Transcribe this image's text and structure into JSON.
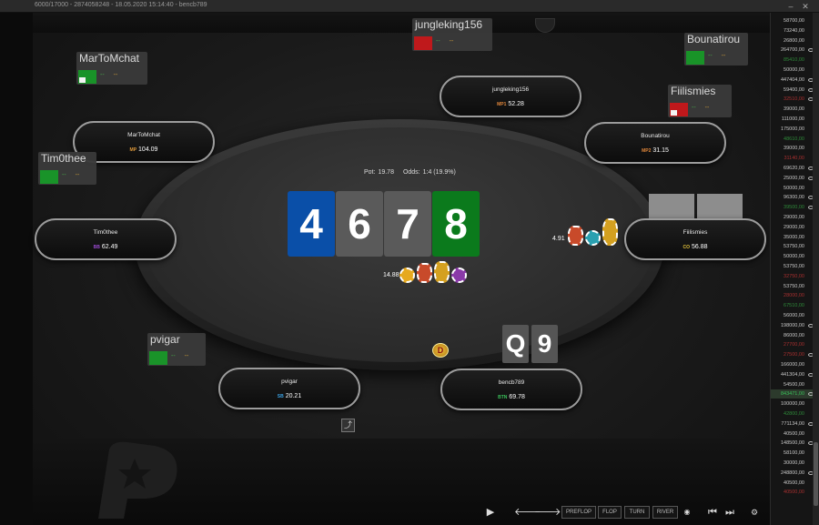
{
  "window": {
    "title": "6000/17000 - 2874058248 - 18.05.2020 15:14:40 - bencb789",
    "minimize_glyph": "–",
    "close_glyph": "✕"
  },
  "pot": {
    "pot_label": "Pot:",
    "pot_value": "19.78",
    "odds_label": "Odds:",
    "odds_value": "1:4 (19.9%)"
  },
  "board": [
    {
      "rank": "4",
      "color": "#0a4fa8"
    },
    {
      "rank": "6",
      "color": "#5a5a5a"
    },
    {
      "rank": "7",
      "color": "#5a5a5a"
    },
    {
      "rank": "8",
      "color": "#0b7a1c"
    }
  ],
  "hero_cards": [
    "Q",
    "9"
  ],
  "seats": [
    {
      "name": "jungleking156",
      "position": "MP1",
      "stack": "52.28",
      "pos_color": "#e0863a"
    },
    {
      "name": "MarToMchat",
      "position": "MP",
      "stack": "104.09",
      "pos_color": "#e09a3a"
    },
    {
      "name": "Bounatirou",
      "position": "MP2",
      "stack": "31.15",
      "pos_color": "#e0863a"
    },
    {
      "name": "Tim0thee",
      "position": "BB",
      "stack": "62.49",
      "pos_color": "#9a4ad0"
    },
    {
      "name": "Fiilismies",
      "position": "CO",
      "stack": "56.88",
      "pos_color": "#e0c03a"
    },
    {
      "name": "pvigar",
      "position": "SB",
      "stack": "20.21",
      "pos_color": "#3aa0e0"
    },
    {
      "name": "bencb789",
      "position": "BTN",
      "stack": "69.78",
      "pos_color": "#3ac05a"
    }
  ],
  "huds": [
    {
      "name": "jungleking156",
      "sq": "#c8191c",
      "stat_a": "--",
      "stat_b": "--"
    },
    {
      "name": "MarToMchat",
      "sq": "#1a9a2a",
      "stat_a": "--",
      "stat_b": "--"
    },
    {
      "name": "Bounatirou",
      "sq": "#1a9a2a",
      "stat_a": "--",
      "stat_b": "--"
    },
    {
      "name": "Fiilismies",
      "sq": "#c8191c",
      "stat_a": "--",
      "stat_b": "--"
    },
    {
      "name": "Tim0thee",
      "sq": "#1a9a2a",
      "stat_a": "--",
      "stat_b": "--"
    },
    {
      "name": "pvigar",
      "sq": "#1a9a2a",
      "stat_a": "--",
      "stat_b": "--"
    }
  ],
  "bets": {
    "pot_chips": "14.88",
    "fiilismies_bet": "4.91"
  },
  "dealer_label": "D",
  "controls": {
    "play": "▶",
    "prev": "🡐",
    "next": "🡒",
    "preflop": "PREFLOP",
    "flop": "FLOP",
    "turn": "TURN",
    "river": "RIVER",
    "eye": "◉",
    "first": "⏮",
    "last": "⏭",
    "settings": "⚙"
  },
  "side_list": [
    {
      "value": "58700,00",
      "color": "#c8c8c8",
      "eye": false
    },
    {
      "value": "73240,00",
      "color": "#c8c8c8",
      "eye": false
    },
    {
      "value": "26800,00",
      "color": "#c8c8c8",
      "eye": false
    },
    {
      "value": "264700,00",
      "color": "#c8c8c8",
      "eye": true
    },
    {
      "value": "85410,00",
      "color": "#2f8a3a",
      "eye": false
    },
    {
      "value": "50000,00",
      "color": "#c8c8c8",
      "eye": false
    },
    {
      "value": "447404,00",
      "color": "#c8c8c8",
      "eye": true
    },
    {
      "value": "59400,00",
      "color": "#c8c8c8",
      "eye": true
    },
    {
      "value": "32510,00",
      "color": "#a83030",
      "eye": true
    },
    {
      "value": "39000,00",
      "color": "#c8c8c8",
      "eye": false
    },
    {
      "value": "111000,00",
      "color": "#c8c8c8",
      "eye": false
    },
    {
      "value": "175000,00",
      "color": "#c8c8c8",
      "eye": false
    },
    {
      "value": "48610,00",
      "color": "#2f8a3a",
      "eye": false
    },
    {
      "value": "39000,00",
      "color": "#c8c8c8",
      "eye": false
    },
    {
      "value": "31140,00",
      "color": "#a83030",
      "eye": false
    },
    {
      "value": "69620,00",
      "color": "#c8c8c8",
      "eye": true
    },
    {
      "value": "25000,00",
      "color": "#c8c8c8",
      "eye": true
    },
    {
      "value": "50000,00",
      "color": "#c8c8c8",
      "eye": false
    },
    {
      "value": "96300,00",
      "color": "#c8c8c8",
      "eye": true
    },
    {
      "value": "39500,00",
      "color": "#2f8a3a",
      "eye": true
    },
    {
      "value": "29000,00",
      "color": "#c8c8c8",
      "eye": false
    },
    {
      "value": "29000,00",
      "color": "#c8c8c8",
      "eye": false
    },
    {
      "value": "35000,00",
      "color": "#c8c8c8",
      "eye": false
    },
    {
      "value": "53750,00",
      "color": "#c8c8c8",
      "eye": false
    },
    {
      "value": "50000,00",
      "color": "#c8c8c8",
      "eye": false
    },
    {
      "value": "53750,00",
      "color": "#c8c8c8",
      "eye": false
    },
    {
      "value": "32750,00",
      "color": "#a83030",
      "eye": false
    },
    {
      "value": "53750,00",
      "color": "#c8c8c8",
      "eye": false
    },
    {
      "value": "28000,00",
      "color": "#a83030",
      "eye": false
    },
    {
      "value": "67510,00",
      "color": "#2f8a3a",
      "eye": false
    },
    {
      "value": "56000,00",
      "color": "#c8c8c8",
      "eye": false
    },
    {
      "value": "198000,00",
      "color": "#c8c8c8",
      "eye": true
    },
    {
      "value": "86000,00",
      "color": "#c8c8c8",
      "eye": false
    },
    {
      "value": "27700,00",
      "color": "#a83030",
      "eye": false
    },
    {
      "value": "27500,00",
      "color": "#a83030",
      "eye": true
    },
    {
      "value": "166000,00",
      "color": "#c8c8c8",
      "eye": false
    },
    {
      "value": "441304,00",
      "color": "#c8c8c8",
      "eye": true
    },
    {
      "value": "54500,00",
      "color": "#c8c8c8",
      "eye": false
    },
    {
      "value": "843471,00",
      "color": "#3ac05a",
      "eye": true
    },
    {
      "value": "100000,00",
      "color": "#c8c8c8",
      "eye": false
    },
    {
      "value": "42800,00",
      "color": "#2f8a3a",
      "eye": false
    },
    {
      "value": "771134,00",
      "color": "#c8c8c8",
      "eye": true
    },
    {
      "value": "40500,00",
      "color": "#c8c8c8",
      "eye": false
    },
    {
      "value": "148500,00",
      "color": "#c8c8c8",
      "eye": true
    },
    {
      "value": "58100,00",
      "color": "#c8c8c8",
      "eye": false
    },
    {
      "value": "30000,00",
      "color": "#c8c8c8",
      "eye": false
    },
    {
      "value": "248800,00",
      "color": "#c8c8c8",
      "eye": true
    },
    {
      "value": "40500,00",
      "color": "#c8c8c8",
      "eye": false
    },
    {
      "value": "40500,00",
      "color": "#a83030",
      "eye": false
    }
  ]
}
